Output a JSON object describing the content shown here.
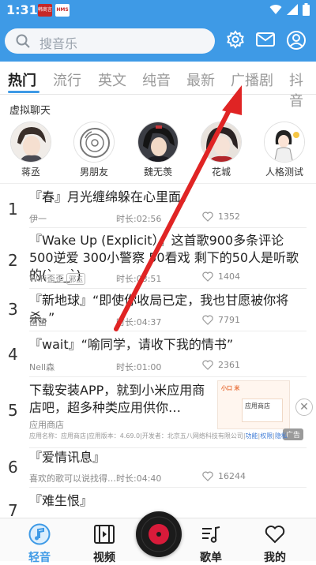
{
  "status": {
    "time": "1:31",
    "notif1_text": "韩商言",
    "notif2_text": "HMS"
  },
  "search": {
    "placeholder": "搜音乐"
  },
  "tabs": [
    {
      "label": "热门",
      "active": true
    },
    {
      "label": "流行"
    },
    {
      "label": "英文"
    },
    {
      "label": "纯音"
    },
    {
      "label": "最新"
    },
    {
      "label": "广播剧"
    },
    {
      "label": "抖音"
    }
  ],
  "virtual_chat": {
    "title": "虚拟聊天",
    "items": [
      {
        "name": "蒋丞"
      },
      {
        "name": "男朋友"
      },
      {
        "name": "魏无羡"
      },
      {
        "name": "花城"
      },
      {
        "name": "人格测试"
      }
    ]
  },
  "songs": [
    {
      "rank": "1",
      "title": "『春』月光缠绵躲在心里面。",
      "author": "伊一",
      "duration": "时长:02:56",
      "likes": "1352"
    },
    {
      "rank": "2",
      "title": "『Wake Up (Explicit）』这首歌900多条评论 500逆爱 300小警察 50看戏 剩下的50人是听歌的(`_._ˋ)",
      "author": "WiFi歪歪",
      "tag": "邪玉",
      "duration": "时长:03:51",
      "likes": "1404"
    },
    {
      "rank": "3",
      "title": "『新地球』“即使你收局已定，我也甘愿被你将杀。”",
      "author": "菌菌",
      "duration": "时长:04:37",
      "likes": "7791"
    },
    {
      "rank": "4",
      "title": "『wait』“喻同学，请收下我的情书”",
      "author": "Nell森",
      "duration": "时长:01:00",
      "likes": "2361"
    },
    {
      "rank": "6",
      "title": "『爱情讯息』",
      "author": "喜欢的歌可以说找得…",
      "duration": "时长:04:40",
      "likes": "16244"
    },
    {
      "rank": "7",
      "title": "『难生恨』",
      "author": "",
      "duration": "",
      "likes": ""
    }
  ],
  "ad": {
    "rank": "5",
    "title": "下载安装APP，就到小米应用商店吧，超多种类应用供你…",
    "source": "应用商店",
    "footer": "应用名称：应用商店|应用版本：4.69.0|开发者：北京五八网络科技有限公司|",
    "links": [
      "功能",
      "权限",
      "隐私"
    ],
    "badge": "广告",
    "image_text": "应用商店",
    "image_brand": "小口 米"
  },
  "bottom_nav": [
    {
      "label": "轻音",
      "icon": "music-note-icon",
      "active": true
    },
    {
      "label": "视频",
      "icon": "film-icon"
    },
    {
      "label": "歌单",
      "icon": "playlist-icon"
    },
    {
      "label": "我的",
      "icon": "heart-icon"
    }
  ],
  "colors": {
    "primary": "#3e9ae6",
    "annotation_arrow": "#e02424",
    "disc": "#d81b3a"
  }
}
